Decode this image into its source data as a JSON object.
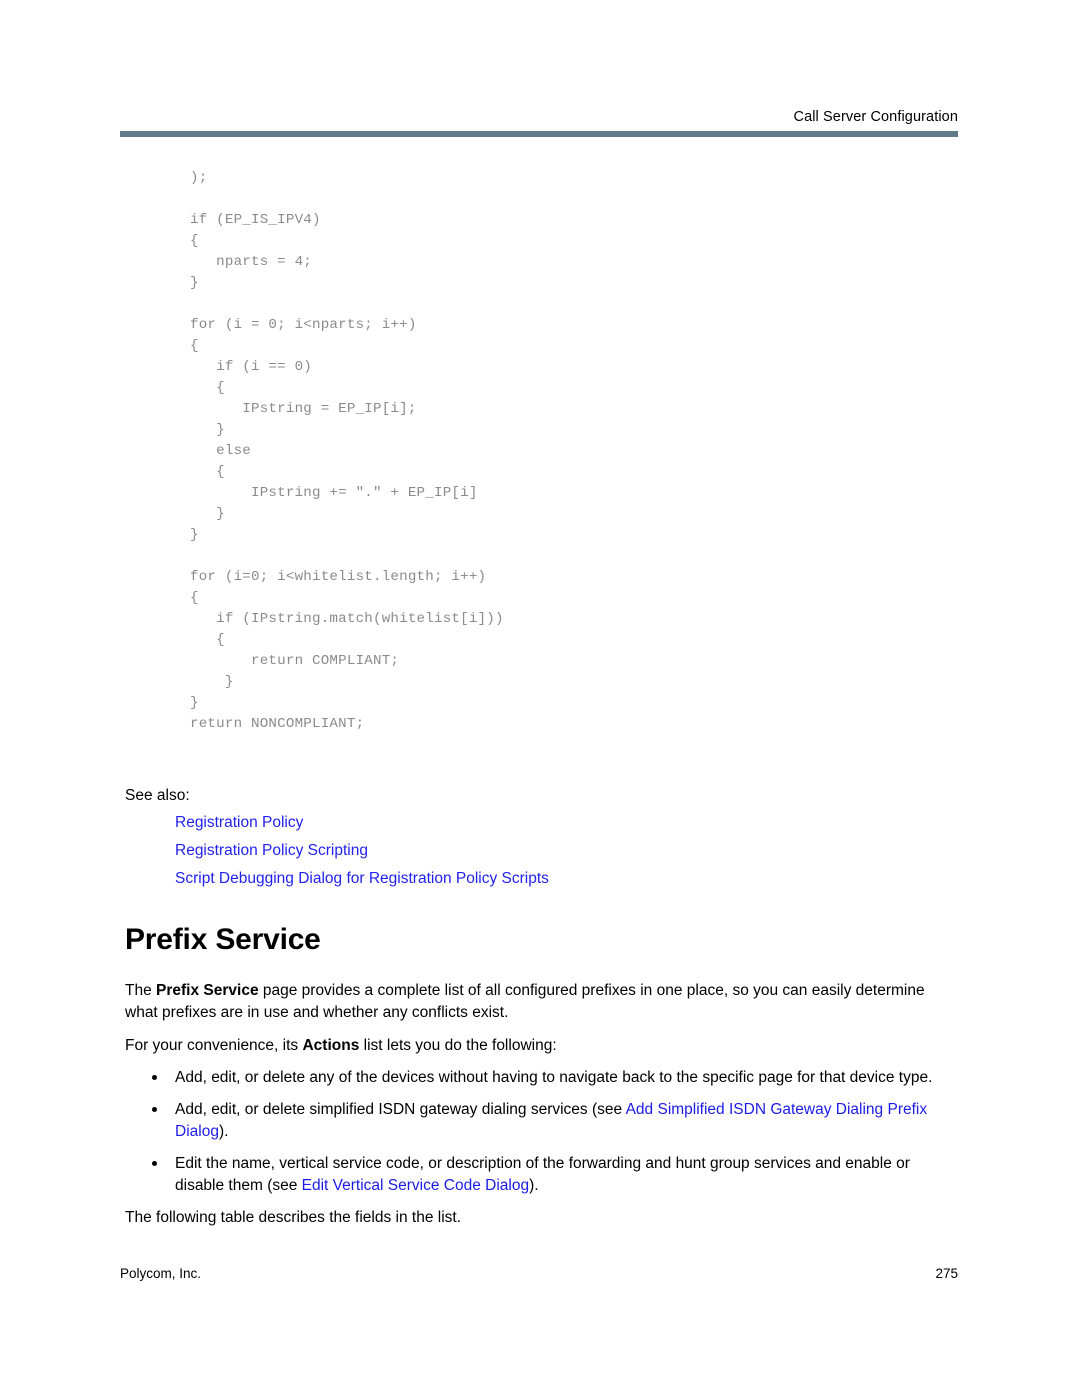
{
  "header": {
    "chapter_title": "Call Server Configuration",
    "rule_color": "#5f7b8a"
  },
  "code_block": {
    "language": "javascript",
    "lines": [
      ");",
      "",
      "if (EP_IS_IPV4)",
      "{",
      "   nparts = 4;",
      "}",
      "",
      "for (i = 0; i<nparts; i++)",
      "{",
      "   if (i == 0)",
      "   {",
      "      IPstring = EP_IP[i];",
      "   }",
      "   else",
      "   {",
      "       IPstring += \".\" + EP_IP[i]",
      "   }",
      "}",
      "",
      "for (i=0; i<whitelist.length; i++)",
      "{",
      "   if (IPstring.match(whitelist[i]))",
      "   {",
      "       return COMPLIANT;",
      "    }",
      "}",
      "return NONCOMPLIANT;"
    ]
  },
  "see_also": {
    "label": "See also:",
    "links": [
      "Registration Policy",
      "Registration Policy Scripting",
      "Script Debugging Dialog for Registration Policy Scripts"
    ],
    "link_color": "#2222ee"
  },
  "section": {
    "title": "Prefix Service",
    "intro_before_bold": "The ",
    "intro_bold": "Prefix Service",
    "intro_after_bold": " page provides a complete list of all configured prefixes in one place, so you can easily determine what prefixes are in use and whether any conflicts exist.",
    "actions_before_bold": "For your convenience, its ",
    "actions_bold": "Actions",
    "actions_after_bold": " list lets you do the following:",
    "bullets": [
      {
        "text": "Add, edit, or delete any of the devices without having to navigate back to the specific page for that device type.",
        "link": "",
        "text_after_link": ""
      },
      {
        "text": "Add, edit, or delete simplified ISDN gateway dialing services (see ",
        "link": "Add Simplified ISDN Gateway Dialing Prefix Dialog",
        "text_after_link": ")."
      },
      {
        "text": "Edit the name, vertical service code, or description of the forwarding and hunt group services and enable or disable them (see ",
        "link": "Edit Vertical Service Code Dialog",
        "text_after_link": ")."
      }
    ],
    "closing": "The following table describes the fields in the list.",
    "inline_link_color": "#1c1ce8"
  },
  "footer": {
    "company": "Polycom, Inc.",
    "page_number": "275"
  }
}
